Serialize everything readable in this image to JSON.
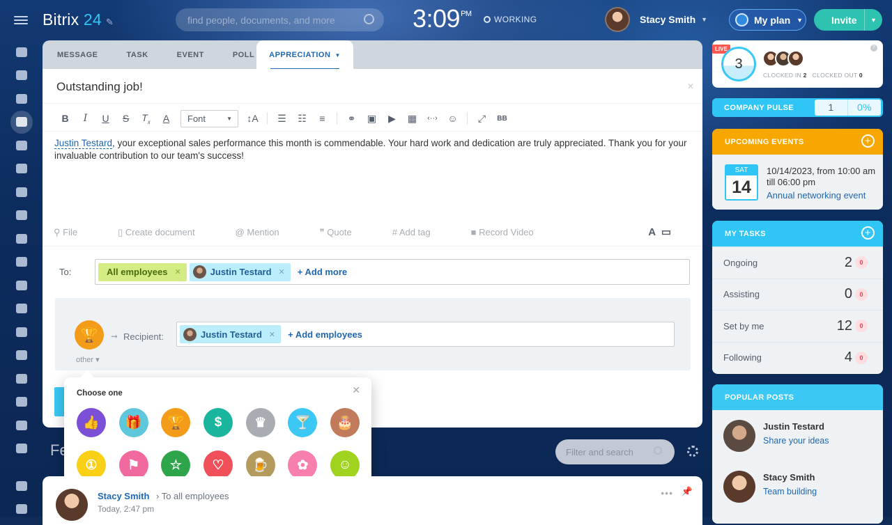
{
  "header": {
    "logo_main": "Bitrix",
    "logo_accent": "24",
    "search_placeholder": "find people, documents, and more",
    "clock_time": "3:09",
    "clock_ampm": "PM",
    "status": "WORKING",
    "user_name": "Stacy Smith",
    "my_plan": "My plan",
    "invite": "Invite"
  },
  "sidebar": {
    "icons": [
      "menu-icon",
      "filter-icon",
      "bank-icon",
      "crm-icon",
      "feed-icon",
      "chat-icon",
      "calendar-icon",
      "docs-icon",
      "drive-icon",
      "mail-icon",
      "groups-icon",
      "goals-icon",
      "shop-icon",
      "tasks-icon",
      "contacts-icon",
      "robot-icon",
      "sign-icon",
      "box-icon",
      "more-icon",
      "help-icon",
      "sitemap-icon"
    ]
  },
  "composer": {
    "tabs": [
      "MESSAGE",
      "TASK",
      "EVENT",
      "POLL"
    ],
    "active_tab": "APPRECIATION",
    "title": "Outstanding job!",
    "font_select": "Font",
    "mention_name": "Justin Testard",
    "message_rest": ", your exceptional sales performance this month is commendable. Your hard work and dedication are truly appreciated. Thank you for your invaluable contribution to our team's success!",
    "attachments": [
      "File",
      "Create document",
      "Mention",
      "Quote",
      "Add tag",
      "Record Video"
    ],
    "to_label": "To:",
    "to_chips": [
      "All employees",
      "Justin Testard"
    ],
    "add_more": "+ Add more",
    "recipient_label": "Recipient:",
    "recipient_chip": "Justin Testard",
    "add_employees": "+ Add employees",
    "badge_type": "other"
  },
  "popup": {
    "title": "Choose one",
    "badges": [
      {
        "name": "thumbs-up",
        "color": "#7b4fd6",
        "glyph": "👍"
      },
      {
        "name": "gift",
        "color": "#5fc7dc",
        "glyph": "🎁"
      },
      {
        "name": "trophy",
        "color": "#f39c1a",
        "glyph": "🏆"
      },
      {
        "name": "money-bag",
        "color": "#19b59c",
        "glyph": "$"
      },
      {
        "name": "crown",
        "color": "#a9adb3",
        "glyph": "♛"
      },
      {
        "name": "cocktail",
        "color": "#3bc8f5",
        "glyph": "🍸"
      },
      {
        "name": "cake",
        "color": "#c17a5a",
        "glyph": "🎂"
      },
      {
        "name": "number-one",
        "color": "#f9d016",
        "glyph": "①"
      },
      {
        "name": "flag",
        "color": "#f06aa0",
        "glyph": "⚑"
      },
      {
        "name": "star",
        "color": "#2ea54a",
        "glyph": "☆"
      },
      {
        "name": "heart",
        "color": "#f0505a",
        "glyph": "♡"
      },
      {
        "name": "beer",
        "color": "#b49a5c",
        "glyph": "🍺"
      },
      {
        "name": "flower",
        "color": "#f77fae",
        "glyph": "✿"
      },
      {
        "name": "smile",
        "color": "#9fd31f",
        "glyph": "☺"
      }
    ]
  },
  "feed": {
    "title": "Fe",
    "filter_placeholder": "Filter and search",
    "post_author": "Stacy Smith",
    "post_to": "To all employees",
    "post_date": "Today, 2:47 pm"
  },
  "right": {
    "live": "LIVE",
    "clocked_in_count": "3",
    "clocked_in_label": "CLOCKED IN",
    "clocked_in_value": "2",
    "clocked_out_label": "CLOCKED OUT",
    "clocked_out_value": "0",
    "pulse_label": "COMPANY PULSE",
    "pulse_value": "1",
    "pulse_percent": "0%",
    "events_title": "UPCOMING EVENTS",
    "event_day": "SAT",
    "event_date": "14",
    "event_when": "10/14/2023, from 10:00 am till 06:00 pm",
    "event_name": "Annual networking event",
    "tasks_title": "MY TASKS",
    "tasks": [
      {
        "label": "Ongoing",
        "count": "2",
        "badge": "0"
      },
      {
        "label": "Assisting",
        "count": "0",
        "badge": "0"
      },
      {
        "label": "Set by me",
        "count": "12",
        "badge": "0"
      },
      {
        "label": "Following",
        "count": "4",
        "badge": "0"
      }
    ],
    "popular_title": "POPULAR POSTS",
    "popular": [
      {
        "name": "Justin Testard",
        "subject": "Share your ideas"
      },
      {
        "name": "Stacy Smith",
        "subject": "Team building"
      }
    ]
  }
}
